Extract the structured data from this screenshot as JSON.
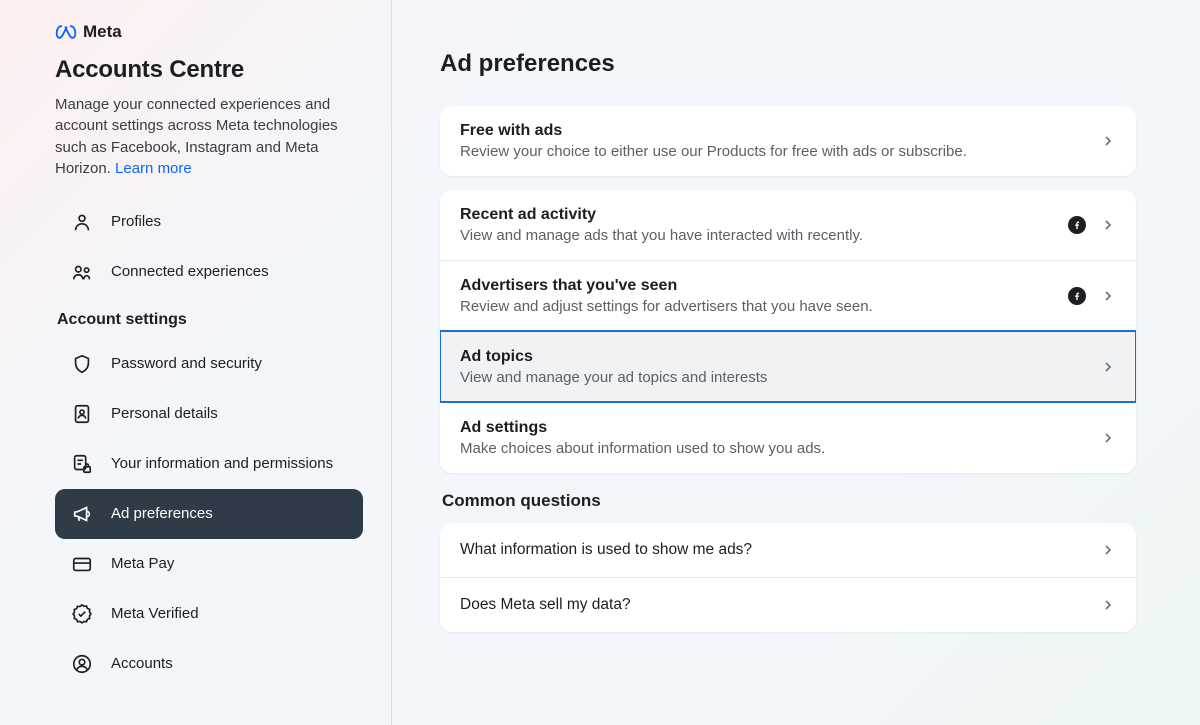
{
  "brand": {
    "name": "Meta"
  },
  "sidebar": {
    "title": "Accounts Centre",
    "description": "Manage your connected experiences and account settings across Meta technologies such as Facebook, Instagram and Meta Horizon. ",
    "learn_more": "Learn more",
    "section_label": "Account settings",
    "items": [
      {
        "label": "Profiles"
      },
      {
        "label": "Connected experiences"
      },
      {
        "label": "Password and security"
      },
      {
        "label": "Personal details"
      },
      {
        "label": "Your information and permissions"
      },
      {
        "label": "Ad preferences"
      },
      {
        "label": "Meta Pay"
      },
      {
        "label": "Meta Verified"
      },
      {
        "label": "Accounts"
      }
    ]
  },
  "main": {
    "title": "Ad preferences",
    "group1": [
      {
        "title": "Free with ads",
        "sub": "Review your choice to either use our Products for free with ads or subscribe."
      }
    ],
    "group2": [
      {
        "title": "Recent ad activity",
        "sub": "View and manage ads that you have interacted with recently.",
        "fb": true
      },
      {
        "title": "Advertisers that you've seen",
        "sub": "Review and adjust settings for advertisers that you have seen.",
        "fb": true
      },
      {
        "title": "Ad topics",
        "sub": "View and manage your ad topics and interests",
        "selected": true
      },
      {
        "title": "Ad settings",
        "sub": "Make choices about information used to show you ads."
      }
    ],
    "common_questions_label": "Common questions",
    "questions": [
      {
        "title": "What information is used to show me ads?"
      },
      {
        "title": "Does Meta sell my data?"
      }
    ]
  }
}
